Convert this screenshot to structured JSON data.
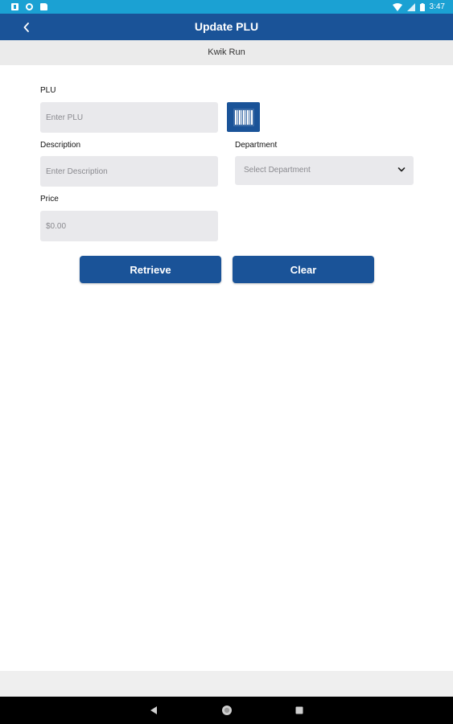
{
  "status_bar": {
    "time": "3:47",
    "icons": [
      "notification-icon",
      "sync-icon",
      "sd-card-icon",
      "wifi-icon",
      "signal-icon",
      "battery-icon"
    ]
  },
  "header": {
    "title": "Update PLU",
    "back_icon": "chevron-left-icon"
  },
  "subheader": {
    "store_name": "Kwik Run"
  },
  "form": {
    "plu": {
      "label": "PLU",
      "placeholder": "Enter PLU",
      "value": ""
    },
    "barcode_icon": "barcode-icon",
    "description": {
      "label": "Description",
      "placeholder": "Enter Description",
      "value": ""
    },
    "department": {
      "label": "Department",
      "selected": "Select Department"
    },
    "price": {
      "label": "Price",
      "placeholder": "$0.00",
      "value": ""
    }
  },
  "actions": {
    "retrieve_label": "Retrieve",
    "clear_label": "Clear"
  },
  "colors": {
    "status_bar": "#1ba1d3",
    "primary": "#1a5398",
    "input_bg": "#e9e9ec",
    "subheader_bg": "#ebebeb"
  },
  "nav": {
    "icons": [
      "back-triangle-icon",
      "home-circle-icon",
      "recents-square-icon"
    ]
  }
}
